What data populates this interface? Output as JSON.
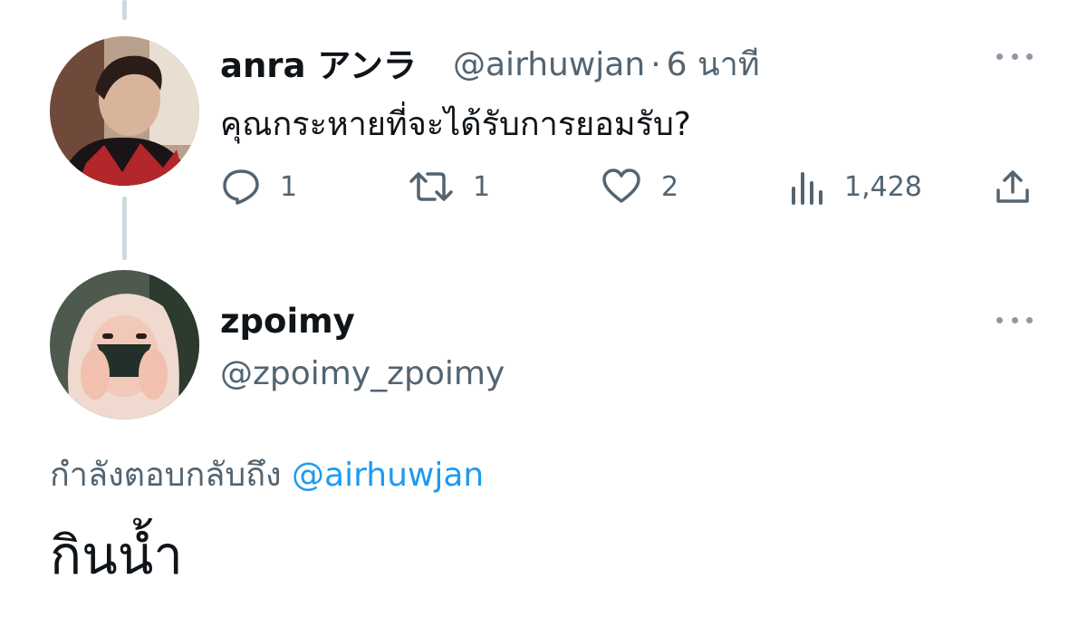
{
  "tweet1": {
    "name": "anra アンラ",
    "handle": "@airhuwjan",
    "separator": "·",
    "time": "6 นาที",
    "text": "คุณกระหายที่จะได้รับการยอมรับ?",
    "actions": {
      "reply_count": "1",
      "retweet_count": "1",
      "like_count": "2",
      "views_count": "1,428"
    },
    "icons": [
      "more-icon",
      "reply-icon",
      "retweet-icon",
      "like-icon",
      "views-icon",
      "share-icon"
    ]
  },
  "tweet2": {
    "name": "zpoimy",
    "handle": "@zpoimy_zpoimy",
    "replying_prefix": "กำลังตอบกลับถึง",
    "replying_mention": "@airhuwjan",
    "text": "กินน้ำ",
    "icons": [
      "more-icon"
    ]
  },
  "colors": {
    "text": "#0f1419",
    "secondary": "#536471",
    "mention": "#1d9bf0",
    "thread_line": "#cfd9de"
  }
}
